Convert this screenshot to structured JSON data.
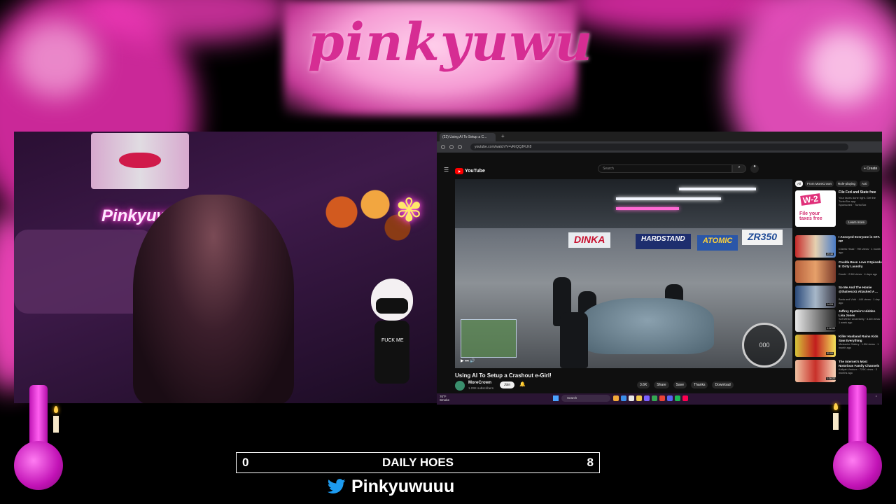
{
  "overlay": {
    "logo_text": "pinkyuwu",
    "goal": {
      "current": "0",
      "label": "DAILY HOES",
      "target": "8"
    },
    "social": {
      "icon": "twitter-bird-icon",
      "handle": "Pinkyuwuuu"
    },
    "colors": {
      "accent_pink": "#e62fa3",
      "light_pink": "#f7a9dc",
      "background": "#000000"
    }
  },
  "webcam": {
    "neon_sign": "Pinkyuwu",
    "avatar_shirt_text": "FUCK ME"
  },
  "browser": {
    "tab_title": "(22) Using AI To Setup a C...",
    "url": "youtube.com/watch?v=vRrQQJFLK8",
    "youtube": {
      "logo_text": "YouTube",
      "search_placeholder": "Search",
      "create_label": "+ Create",
      "video_title": "Using AI To Setup a Crashout e-Girl!",
      "channel_name": "MoreCrown",
      "channel_subs": "1.23K subscribers",
      "join_label": "Join",
      "actions": [
        "3.6K",
        "Share",
        "Save",
        "Thanks",
        "Download"
      ],
      "game_banners": [
        "DINKA",
        "HARDSTAND",
        "ATOMIC",
        "ZR350"
      ],
      "speedometer": "000",
      "chips": [
        "All",
        "From MoreCrown",
        "Role-playing",
        "Acti"
      ],
      "ad": {
        "badge": "W-2",
        "copy_line1": "File your",
        "copy_line2": "taxes free",
        "title": "File Fed and State free",
        "desc": "Your taxes done right. Get the TurboTax app.",
        "sponsor": "Sponsored · TurboTax",
        "button": "Learn more"
      },
      "recommendations": [
        {
          "title": "I Annoyed Everyone in GTA RP",
          "meta": "Cheeto Head · 79K views · 1 month ago",
          "duration": "29:48"
        },
        {
          "title": "Coulda Been Love 2 Episode 8: Dirty Laundry",
          "meta": "Druski · 2.5M views · 4 days ago",
          "duration": ""
        },
        {
          "title": "So Me And The Homie @thatvecotz Attacked A ...",
          "meta": "Bada and Vicki · 44K views · 1 day ago",
          "duration": "14:24"
        },
        {
          "title": "Jeffrey Epstein's Hidden Lisa Jones",
          "meta": "Soft White Underbelly · 3.4M views · 1 week ago",
          "duration": "1:12:00"
        },
        {
          "title": "Killer Husband Ruins Kids Saw Everything",
          "meta": "Mustache Gallery · 1.5M views · 1 month ago",
          "duration": "32:09"
        },
        {
          "title": "The Internet's Most Notorious Family Channels",
          "meta": "Kaliyah Venture · 729K views · 3 months ago",
          "duration": "1:26:22"
        }
      ]
    },
    "taskbar": {
      "weather_temp": "70°F",
      "weather_desc": "Smoke",
      "search_label": "Search"
    }
  }
}
